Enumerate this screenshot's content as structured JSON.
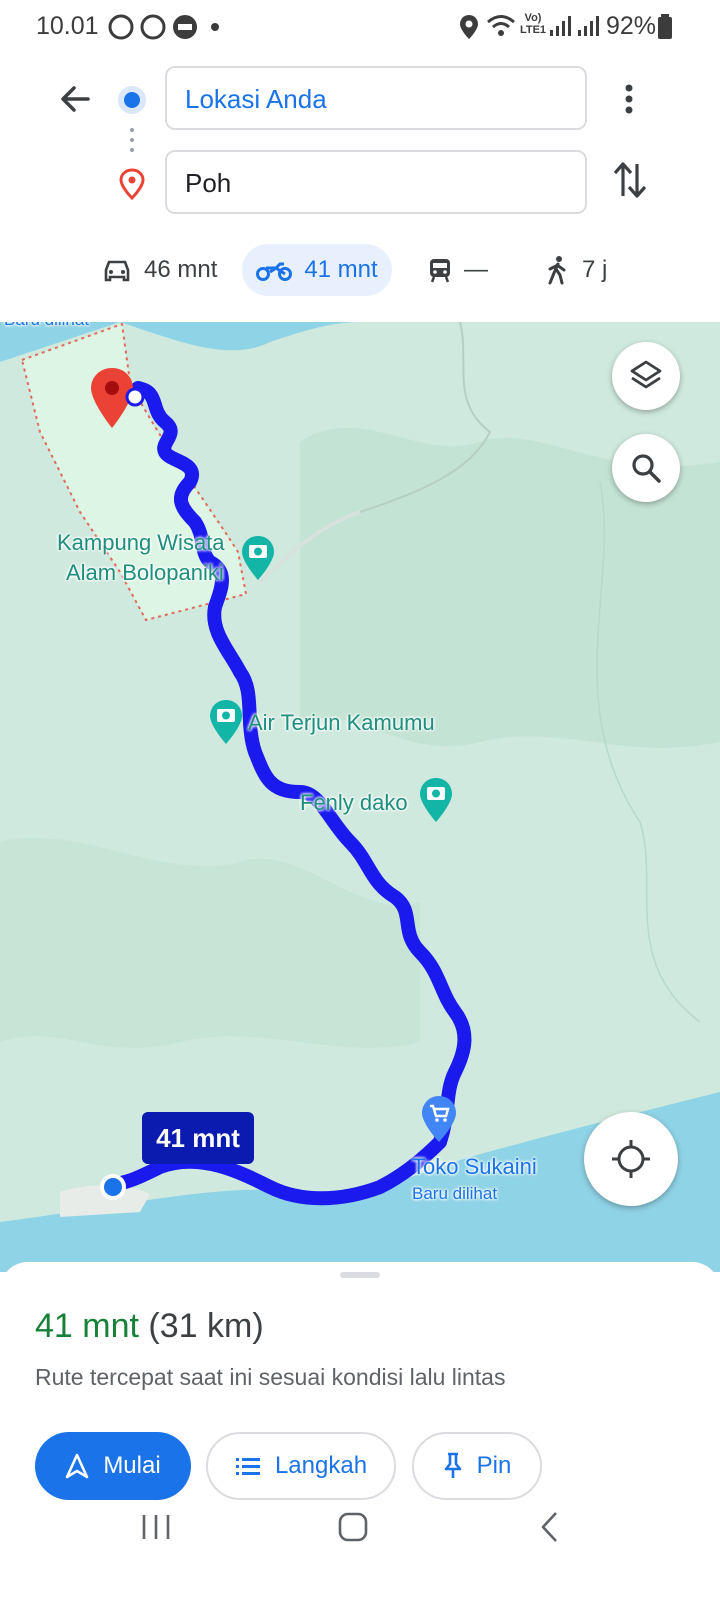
{
  "status_bar": {
    "time": "10.01",
    "battery_percent": "92%",
    "network": "Vo) LTE1"
  },
  "search": {
    "origin": "Lokasi Anda",
    "destination": "Poh"
  },
  "modes": [
    {
      "icon": "car-icon",
      "label": "46 mnt"
    },
    {
      "icon": "motorcycle-icon",
      "label": "41 mnt",
      "selected": true
    },
    {
      "icon": "transit-icon",
      "label": "—"
    },
    {
      "icon": "walk-icon",
      "label": "7 j"
    }
  ],
  "map": {
    "place_labels": {
      "kampung_line1": "Kampung Wisata",
      "kampung_line2": "Alam Bolopaniki",
      "waterfall": "Air Terjun Kamumu",
      "fenly": "Fenly dako",
      "shop": "Toko Sukaini",
      "shop_sub": "Baru dilihat",
      "top_partial": "Baru dilihat"
    },
    "eta_badge": "41 mnt",
    "route_color": "#1a1aee"
  },
  "summary": {
    "duration": "41 mnt",
    "distance": "(31 km)",
    "description": "Rute tercepat saat ini sesuai kondisi lalu lintas"
  },
  "actions": {
    "start": "Mulai",
    "steps": "Langkah",
    "pin": "Pin"
  },
  "colors": {
    "accent": "#1a73e8",
    "duration_green": "#188038",
    "map_land": "#cfe9de",
    "water": "#8fd3e6"
  }
}
